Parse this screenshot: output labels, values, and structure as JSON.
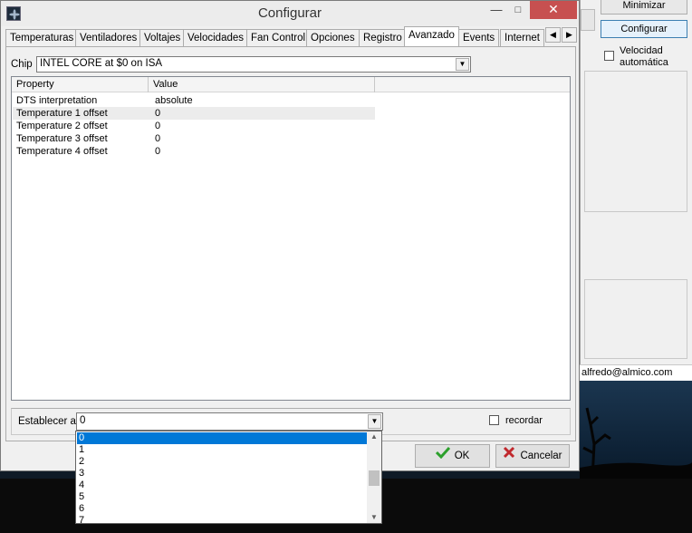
{
  "background_app": {
    "minimize_label": "Minimizar",
    "configure_label": "Configurar",
    "auto_speed_label_line1": "Velocidad",
    "auto_speed_label_line2": "automática",
    "email": "alfredo@almico.com"
  },
  "dialog": {
    "title": "Configurar",
    "minimize_glyph": "—",
    "maximize_glyph": "□",
    "close_glyph": "✕",
    "tabs": [
      {
        "label": "Temperaturas"
      },
      {
        "label": "Ventiladores"
      },
      {
        "label": "Voltajes"
      },
      {
        "label": "Velocidades"
      },
      {
        "label": "Fan Control"
      },
      {
        "label": "Opciones"
      },
      {
        "label": "Registro"
      },
      {
        "label": "Avanzado",
        "active": true
      },
      {
        "label": "Events"
      },
      {
        "label": "Internet"
      }
    ],
    "chip": {
      "label": "Chip",
      "value": "INTEL CORE at $0 on ISA"
    },
    "grid": {
      "columns": [
        "Property",
        "Value"
      ],
      "rows": [
        {
          "property": "DTS interpretation",
          "value": "absolute"
        },
        {
          "property": "Temperature 1 offset",
          "value": "0"
        },
        {
          "property": "Temperature 2 offset",
          "value": "0"
        },
        {
          "property": "Temperature 3 offset",
          "value": "0"
        },
        {
          "property": "Temperature 4 offset",
          "value": "0"
        }
      ]
    },
    "set_to": {
      "label": "Establecer a",
      "value": "0",
      "options": [
        "0",
        "1",
        "2",
        "3",
        "4",
        "5",
        "6",
        "7"
      ]
    },
    "remember_label": "recordar",
    "ok_label": "OK",
    "cancel_label": "Cancelar"
  },
  "colors": {
    "selection": "#0078d7",
    "close_button": "#c75050",
    "ok_check": "#2ca02c",
    "cancel_x": "#c0282d"
  }
}
